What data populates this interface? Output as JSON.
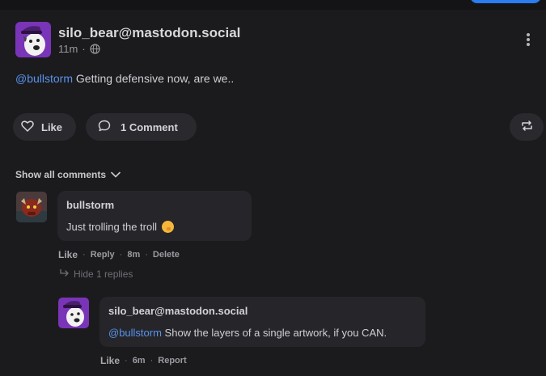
{
  "post": {
    "author": "silo_bear@mastodon.social",
    "time": "11m",
    "separator": "·",
    "visibility_icon": "globe-icon",
    "text_mention": "@bullstorm",
    "text_body": " Getting defensive now, are we..",
    "more_icon": "vertical-dots-icon"
  },
  "actions": {
    "like_label": "Like",
    "comment_label": "1 Comment",
    "repost_icon": "repost-icon"
  },
  "comments_toggle": {
    "label": "Show all comments"
  },
  "comments": [
    {
      "author": "bullstorm",
      "text": "Just trolling the troll",
      "emoji": "hand-over-mouth-emoji",
      "like_label": "Like",
      "reply_label": "Reply",
      "time": "8m",
      "delete_label": "Delete",
      "hide_replies_label": "Hide 1 replies"
    }
  ],
  "reply": {
    "author": "silo_bear@mastodon.social",
    "text_mention": "@bullstorm",
    "text_body": " Show the layers of a single artwork, if you CAN.",
    "like_label": "Like",
    "time": "6m",
    "report_label": "Report"
  },
  "colors": {
    "background": "#1b1b1e",
    "surface": "#29292e",
    "mention": "#5a92ea",
    "avatar_purple": "#7a34b8"
  }
}
